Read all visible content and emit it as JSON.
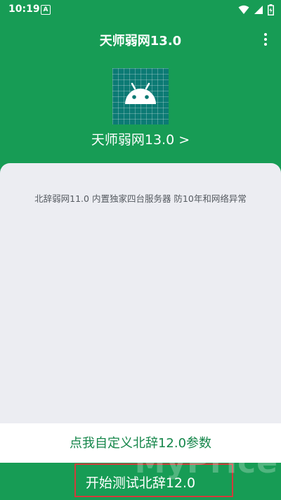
{
  "status_bar": {
    "time": "10:19",
    "notification_badge": "A",
    "icons": [
      "wifi-icon",
      "signal-icon",
      "battery-icon"
    ]
  },
  "toolbar": {
    "title": "天师弱网13.0",
    "menu_icon": "more-vert-icon"
  },
  "header": {
    "app_name": "天师弱网13.0 >"
  },
  "card": {
    "description": "北辞弱网11.0 内置独家四台服务器 防10年和网络异常"
  },
  "actions": {
    "custom_label": "点我自定义北辞12.0参数",
    "start_label": "开始测试北辞12.0"
  },
  "watermark": "MyPrice",
  "colors": {
    "primary": "#179c55",
    "card_bg": "#ecedf2",
    "custom_text": "#15864a",
    "highlight": "#d23b3b"
  }
}
